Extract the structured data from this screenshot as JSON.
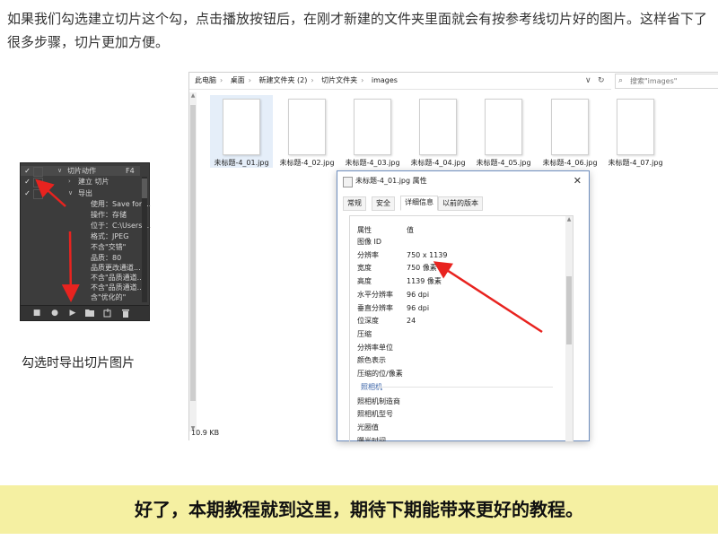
{
  "intro_text": "如果我们勾选建立切片这个勾，点击播放按钮后，在刚才新建的文件夹里面就会有按参考线切片好的图片。这样省下了很多步骤，切片更加方便。",
  "ps_panel": {
    "rows": [
      {
        "check": "✓",
        "tri": "∨",
        "label": "切片动作",
        "extra": "F4"
      },
      {
        "check": "✓",
        "tri": "›",
        "label": "建立 切片",
        "extra": ""
      },
      {
        "check": "✓",
        "tri": "∨",
        "label": "导出",
        "extra": ""
      },
      {
        "check": "",
        "tri": "",
        "label": "使用：Save for ...",
        "extra": ""
      },
      {
        "check": "",
        "tri": "",
        "label": "操作：存储",
        "extra": ""
      },
      {
        "check": "",
        "tri": "",
        "label": "位于：C:\\Users\\...",
        "extra": ""
      },
      {
        "check": "",
        "tri": "",
        "label": "格式：JPEG",
        "extra": ""
      },
      {
        "check": "",
        "tri": "",
        "label": "不含\"交错\"",
        "extra": ""
      },
      {
        "check": "",
        "tri": "",
        "label": "品质：80",
        "extra": ""
      },
      {
        "check": "",
        "tri": "",
        "label": "品质更改通道...",
        "extra": ""
      },
      {
        "check": "",
        "tri": "",
        "label": "不含\"品质通道...",
        "extra": ""
      },
      {
        "check": "",
        "tri": "",
        "label": "不含\"品质通道...",
        "extra": ""
      },
      {
        "check": "",
        "tri": "",
        "label": "含\"优化的\"",
        "extra": ""
      }
    ],
    "bottom_buttons": [
      "stop-icon",
      "record-icon",
      "play-icon",
      "folder-icon",
      "new-action-icon",
      "trash-icon"
    ]
  },
  "ps_caption": "勾选时导出切片图片",
  "explorer": {
    "breadcrumb": [
      "此电脑",
      "桌面",
      "新建文件夹 (2)",
      "切片文件夹",
      "images"
    ],
    "search_placeholder": "搜索\"images\"",
    "status": "10.9 KB",
    "files": [
      "未标题-4_01.jpg",
      "未标题-4_02.jpg",
      "未标题-4_03.jpg",
      "未标题-4_04.jpg",
      "未标题-4_05.jpg",
      "未标题-4_06.jpg",
      "未标题-4_07.jpg"
    ]
  },
  "dialog": {
    "title": "未标题-4_01.jpg 属性",
    "close": "✕",
    "tabs": [
      "常规",
      "安全",
      "详细信息",
      "以前的版本"
    ],
    "active_tab": "详细信息",
    "header": {
      "k": "属性",
      "v": "值"
    },
    "rows": [
      {
        "k": "图像 ID",
        "v": ""
      },
      {
        "k": "分辨率",
        "v": "750 x 1139"
      },
      {
        "k": "宽度",
        "v": "750 像素"
      },
      {
        "k": "高度",
        "v": "1139 像素"
      },
      {
        "k": "水平分辨率",
        "v": "96 dpi"
      },
      {
        "k": "垂直分辨率",
        "v": "96 dpi"
      },
      {
        "k": "位深度",
        "v": "24"
      },
      {
        "k": "压缩",
        "v": ""
      },
      {
        "k": "分辨率单位",
        "v": ""
      },
      {
        "k": "颜色表示",
        "v": ""
      },
      {
        "k": "压缩的位/像素",
        "v": ""
      }
    ],
    "group": "照相机",
    "rows2": [
      {
        "k": "照相机制造商",
        "v": ""
      },
      {
        "k": "照相机型号",
        "v": ""
      },
      {
        "k": "光圈值",
        "v": ""
      },
      {
        "k": "曝光时间",
        "v": ""
      }
    ]
  },
  "banner_text": "好了，本期教程就到这里，期待下期能带来更好的教程。",
  "colors": {
    "arrow": "#e8231f",
    "banner_bg": "#f5f0a2",
    "ps_bg": "#3c3c3c",
    "link_blue": "#3b64a8"
  }
}
